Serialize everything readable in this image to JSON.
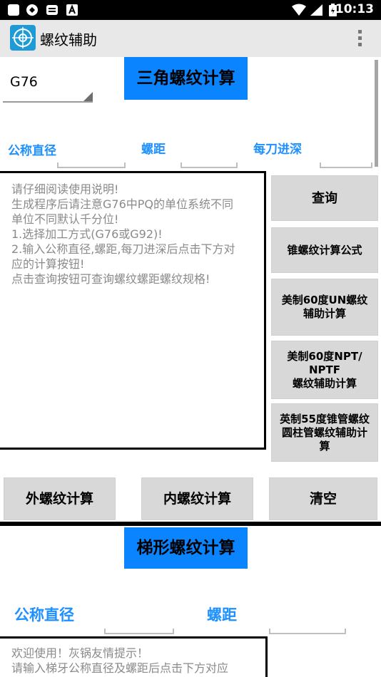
{
  "status_bar": {
    "time": "10:13"
  },
  "app_bar": {
    "title": "螺纹辅助"
  },
  "section1": {
    "dropdown_value": "G76",
    "title_button": "三角螺纹计算",
    "label_diameter": "公称直径",
    "label_pitch": "螺距",
    "label_depth": "每刀进深",
    "instructions": [
      "请仔细阅读使用说明!",
      "生成程序后请注意G76中PQ的单位系统不同",
      "单位不同默认千分位!",
      "1.选择加工方式(G76或G92)!",
      "2.输入公称直径,螺距,每刀进深后点击下方对",
      "应的计算按钮!",
      "点击查询按钮可查询螺纹螺距螺纹规格!"
    ],
    "side_buttons": {
      "query": "查询",
      "taper": "锥螺纹计算公式",
      "un": [
        "美制60度UN螺纹",
        "辅助计算"
      ],
      "npt": [
        "美制60度NPT/",
        "NPTF",
        "螺纹辅助计算"
      ],
      "bsp": [
        "英制55度锥管螺纹",
        "圆柱管螺纹辅助计",
        "算"
      ]
    },
    "bottom_buttons": {
      "external": "外螺纹计算",
      "internal": "内螺纹计算",
      "clear": "清空"
    }
  },
  "section2": {
    "title_button": "梯形螺纹计算",
    "label_diameter": "公称直径",
    "label_pitch": "螺距",
    "instructions": [
      "欢迎使用！灰锅友情提示！",
      "请输入梯牙公称直径及螺距后点击下方对应"
    ]
  }
}
